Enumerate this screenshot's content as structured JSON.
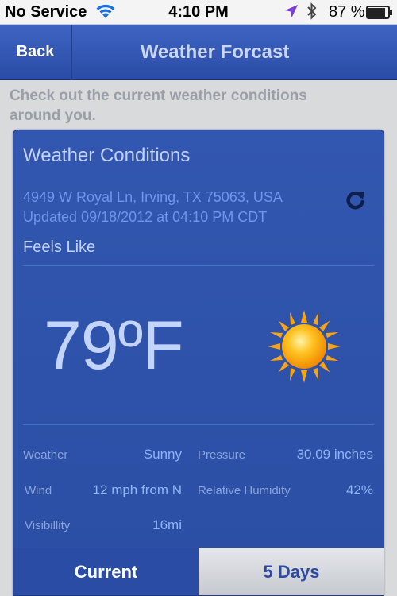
{
  "status_bar": {
    "carrier": "No Service",
    "time": "4:10 PM",
    "battery": "87 %",
    "battery_level": 0.87
  },
  "nav": {
    "back_label": "Back",
    "title": "Weather Forcast"
  },
  "intro_text": "Check out the current weather conditions around you.",
  "conditions": {
    "title": "Weather Conditions",
    "address": "4949 W Royal Ln, Irving, TX 75063, USA",
    "updated": "Updated 09/18/2012 at 04:10 PM CDT",
    "feels_like_label": "Feels Like",
    "temperature": "79ºF",
    "icon": "sun-icon",
    "stats": {
      "weather_label": "Weather",
      "weather_value": "Sunny",
      "pressure_label": "Pressure",
      "pressure_value": "30.09 inches",
      "wind_label": "Wind",
      "wind_value": "12 mph from N",
      "humidity_label": "Relative Humidity",
      "humidity_value": "42%",
      "visibility_label": "Visibillity",
      "visibility_value": "16mi"
    }
  },
  "tabs": {
    "current": "Current",
    "five_days": "5 Days"
  },
  "colors": {
    "nav_blue": "#3359b8",
    "panel_blue": "#2f52a9",
    "text_light_blue": "#c2d1f7",
    "accent_blue": "#6e95ea"
  }
}
